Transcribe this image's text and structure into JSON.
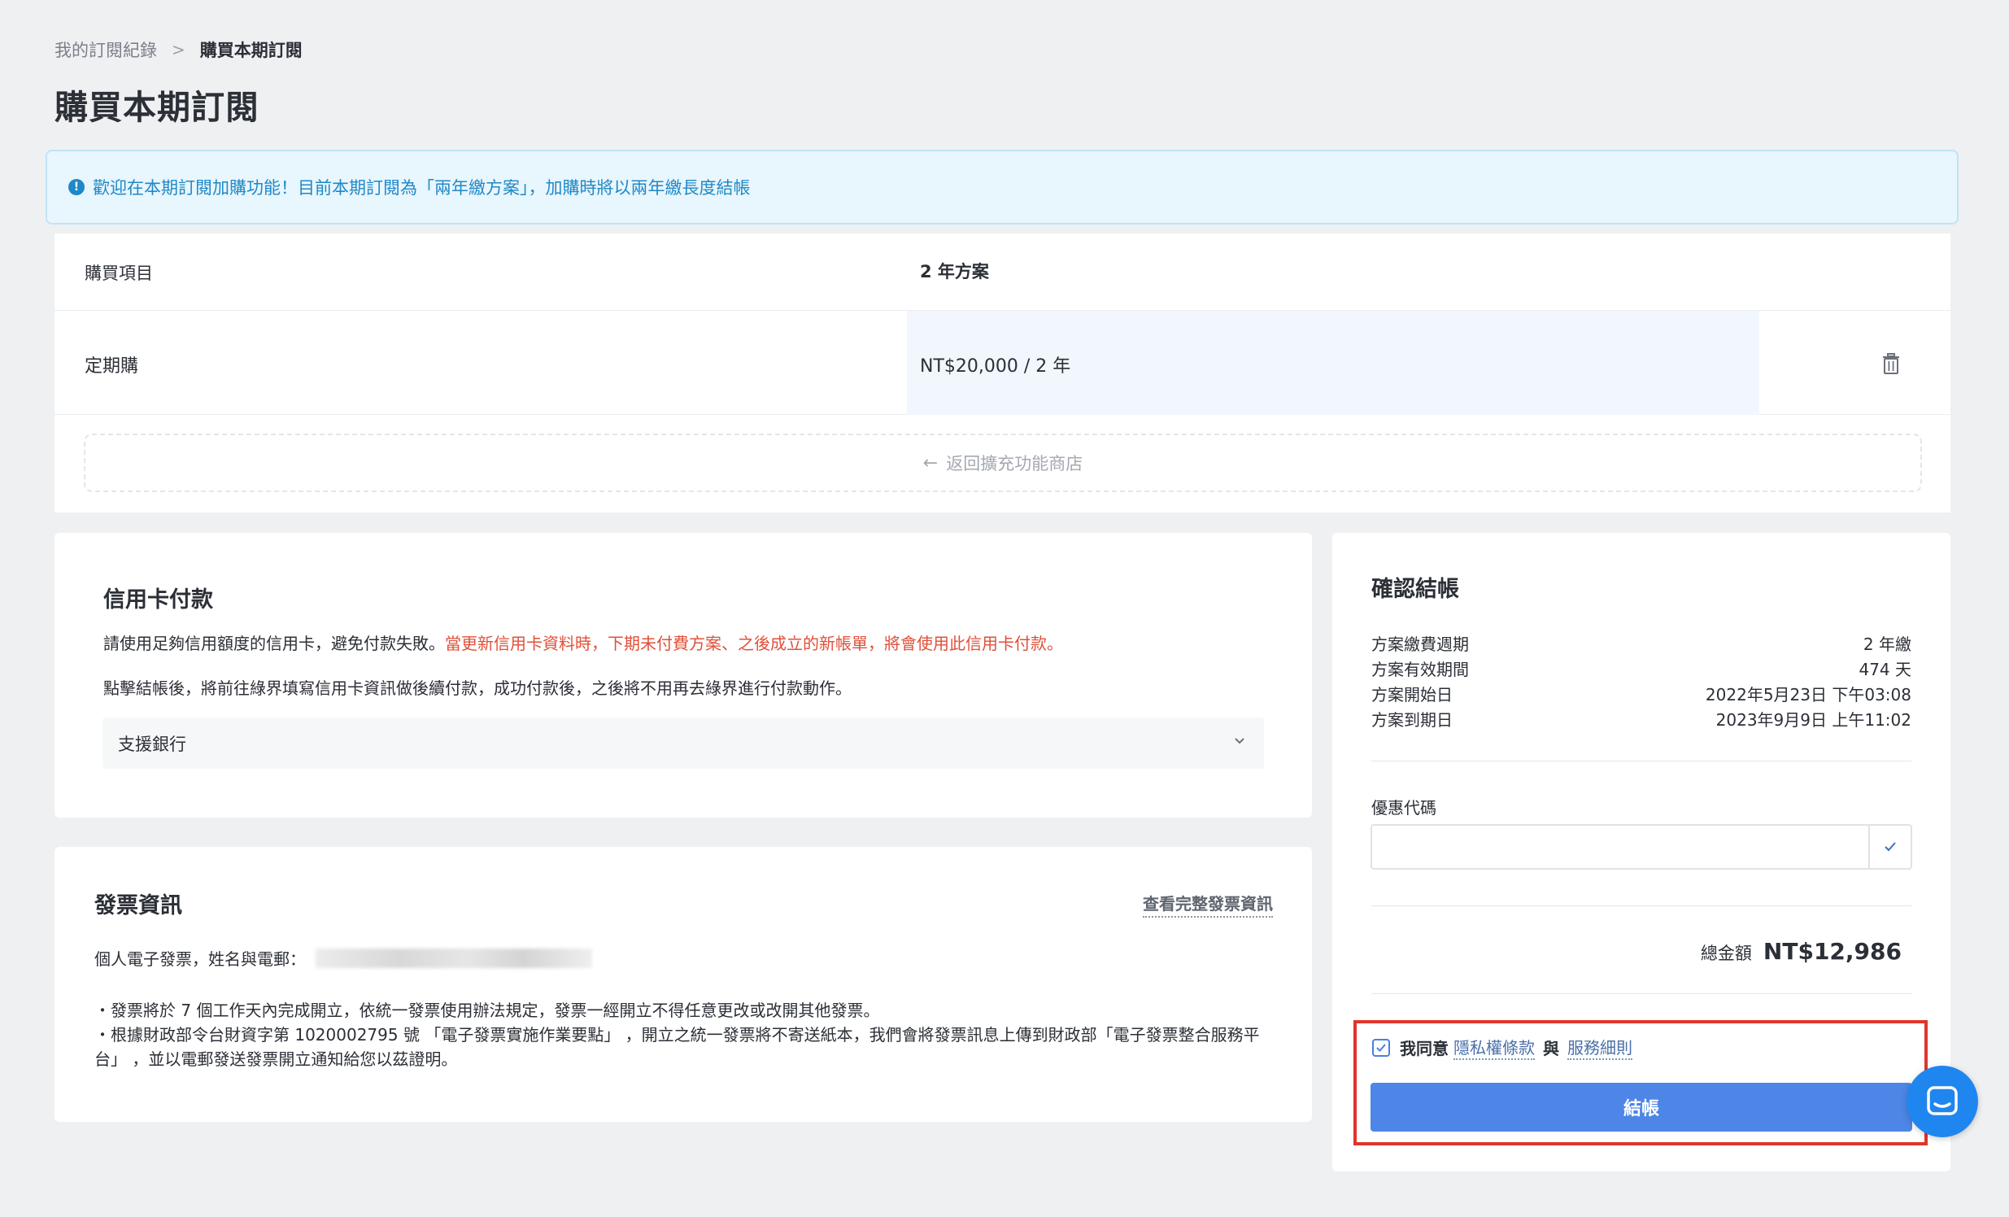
{
  "breadcrumb": {
    "parent": "我的訂閱紀錄",
    "separator": ">",
    "current": "購買本期訂閱"
  },
  "page_title": "購買本期訂閱",
  "banner": {
    "icon": "info-icon",
    "text": "歡迎在本期訂閱加購功能！目前本期訂閱為「兩年繳方案」，加購時將以兩年繳長度結帳",
    "color": "#1f88c8"
  },
  "items": {
    "header_label": "購買項目",
    "header_value": "2 年方案",
    "row_label": "定期購",
    "row_value": "NT$20,000 / 2 年",
    "delete_icon": "trash-icon",
    "back_store": "返回擴充功能商店"
  },
  "credit_card": {
    "title": "信用卡付款",
    "desc_plain": "請使用足夠信用額度的信用卡，避免付款失敗。",
    "desc_warning": "當更新信用卡資料時，下期未付費方案、之後成立的新帳單，將會使用此信用卡付款。",
    "desc2": "點擊結帳後，將前往綠界填寫信用卡資訊做後續付款，成功付款後，之後將不用再去綠界進行付款動作。",
    "bank_select": "支援銀行",
    "warning_color": "#e0503a"
  },
  "invoice": {
    "title": "發票資訊",
    "view_link": "查看完整發票資訊",
    "type_line": "個人電子發票，姓名與電郵：",
    "note1": "・發票將於 7 個工作天內完成開立，依統一發票使用辦法規定，發票一經開立不得任意更改或改開其他發票。",
    "note2": "・根據財政部令台財資字第 1020002795 號 「電子發票實施作業要點」 ，開立之統一發票將不寄送紙本，我們會將發票訊息上傳到財政部「電子發票整合服務平台」 ，並以電郵發送發票開立通知給您以茲證明。"
  },
  "checkout": {
    "title": "確認結帳",
    "rows": [
      {
        "label": "方案繳費週期",
        "value": "2 年繳"
      },
      {
        "label": "方案有效期間",
        "value": "474 天"
      },
      {
        "label": "方案開始日",
        "value": "2022年5月23日 下午03:08"
      },
      {
        "label": "方案到期日",
        "value": "2023年9月9日 上午11:02"
      }
    ],
    "coupon_label": "優惠代碼",
    "coupon_value": "",
    "total_label": "總金額",
    "total_amount": "NT$12,986",
    "agree_prefix": "我同意",
    "privacy_link": "隱私權條款",
    "agree_connector": "與",
    "terms_link": "服務細則",
    "agree_checked": true,
    "button_label": "結帳",
    "button_color": "#4d86e6",
    "highlight_color": "#e0352a"
  },
  "chat": {
    "icon": "chat-icon",
    "color": "#1f86f0"
  }
}
